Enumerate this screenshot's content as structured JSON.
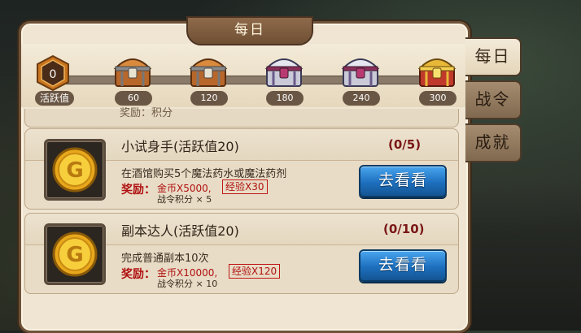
{
  "panel": {
    "title": "每日"
  },
  "activity": {
    "label": "活跃值",
    "value": "0"
  },
  "chests": [
    {
      "milestone": "60",
      "icon": "wooden-chest-icon"
    },
    {
      "milestone": "120",
      "icon": "wooden-chest-icon"
    },
    {
      "milestone": "180",
      "icon": "silver-chest-icon"
    },
    {
      "milestone": "240",
      "icon": "silver-chest-icon"
    },
    {
      "milestone": "300",
      "icon": "gold-chest-icon"
    }
  ],
  "partial_row_text": "奖励：积分",
  "quests": [
    {
      "title": "小试身手(活跃值20)",
      "count": "(0/5)",
      "desc": "在酒馆购买5个魔法药水或魔法药剂",
      "reward_label": "奖励：",
      "gold": "金币X5000,",
      "exp": "经验X30",
      "score": "战令积分 × 5",
      "button": "去看看",
      "icon": "gold-coin-icon"
    },
    {
      "title": "副本达人(活跃值20)",
      "count": "(0/10)",
      "desc": "完成普通副本10次",
      "reward_label": "奖励：",
      "gold": "金币X10000,",
      "exp": "经验X120",
      "score": "战令积分 × 10",
      "button": "去看看",
      "icon": "gold-coin-icon"
    }
  ],
  "side_tabs": [
    {
      "label": "每日",
      "active": true
    },
    {
      "label": "战令",
      "active": false
    },
    {
      "label": "成就",
      "active": false
    }
  ],
  "colors": {
    "panel_bg": "#efe5d2",
    "frame": "#6e5238",
    "button_blue": "#1d6fbe",
    "reward_red": "#b01010"
  }
}
